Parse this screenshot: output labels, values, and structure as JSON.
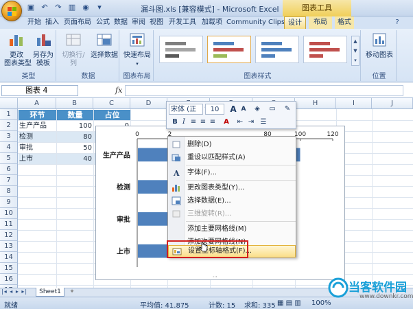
{
  "window": {
    "title": "漏斗图.xls [兼容模式] - Microsoft Excel",
    "context_tab_title": "图表工具"
  },
  "ribbon_tabs": [
    "开始",
    "插入",
    "页面布局",
    "公式",
    "数据",
    "审阅",
    "视图",
    "开发工具",
    "加载项",
    "Community Clips",
    "设计",
    "布局",
    "格式"
  ],
  "ribbon": {
    "groups": {
      "type": "类型",
      "data": "数据",
      "layouts": "图表布局",
      "styles": "图表样式",
      "location": "位置"
    },
    "buttons": {
      "change_type": "更改\n图表类型",
      "save_template": "另存为\n模板",
      "switch_row_col": "切换行/列",
      "select_data": "选择数据",
      "quick_layout": "快速布局",
      "move_chart": "移动图表"
    }
  },
  "formula_bar": {
    "name_box": "图表 4",
    "fx": "fx",
    "value": ""
  },
  "columns": [
    "A",
    "B",
    "C",
    "D",
    "E",
    "F",
    "G",
    "H",
    "I",
    "J"
  ],
  "rows": [
    "1",
    "2",
    "3",
    "4",
    "5",
    "6",
    "7",
    "8",
    "9",
    "10",
    "11",
    "12",
    "13",
    "14",
    "15",
    "16",
    "17"
  ],
  "table": {
    "headers": [
      "环节",
      "数量",
      "占位"
    ],
    "rows": [
      {
        "name": "生产产品",
        "qty": "100",
        "placeholder": "0"
      },
      {
        "name": "检测",
        "qty": "80",
        "placeholder": ""
      },
      {
        "name": "审批",
        "qty": "50",
        "placeholder": ""
      },
      {
        "name": "上市",
        "qty": "40",
        "placeholder": ""
      }
    ]
  },
  "chart_data": {
    "type": "bar",
    "orientation": "horizontal",
    "categories": [
      "生产产品",
      "检测",
      "审批",
      "上市"
    ],
    "x_tick_labels": [
      "0",
      "2",
      "80",
      "100",
      "120"
    ],
    "series": [
      {
        "values": [
          100,
          80,
          50,
          40
        ],
        "color": "#4f81bd"
      }
    ],
    "xlim": [
      0,
      120
    ],
    "gridlines": false
  },
  "mini_toolbar": {
    "font": "宋体 (正",
    "size": "10",
    "grow": "A",
    "shrink": "A",
    "bold": "B",
    "italic": "I"
  },
  "context_menu": {
    "items": [
      {
        "label": "删除(D)",
        "disabled": false,
        "icon": "delete-icon"
      },
      {
        "label": "重设以匹配样式(A)",
        "disabled": false,
        "icon": "reset-style-icon"
      },
      {
        "label": "字体(F)...",
        "disabled": false,
        "icon": "font-icon"
      },
      {
        "label": "更改图表类型(Y)...",
        "disabled": false,
        "icon": "chart-type-icon"
      },
      {
        "label": "选择数据(E)...",
        "disabled": false,
        "icon": "select-data-icon"
      },
      {
        "label": "三维旋转(R)...",
        "disabled": true,
        "icon": "3d-rotate-icon"
      },
      {
        "label": "添加主要网格线(M)",
        "disabled": false,
        "icon": ""
      },
      {
        "label": "添加次要网格线(N)",
        "disabled": false,
        "icon": ""
      },
      {
        "label": "设置坐标轴格式(F)...",
        "disabled": false,
        "icon": "axis-format-icon"
      }
    ]
  },
  "sheet_tabs": [
    "Sheet1"
  ],
  "status_bar": {
    "ready": "就绪",
    "average": "平均值: 41.875",
    "count": "计数: 15",
    "sum": "求和: 335",
    "zoom": "100%"
  },
  "watermark": {
    "text": "当客软件园",
    "url": "www.downkr.com"
  }
}
